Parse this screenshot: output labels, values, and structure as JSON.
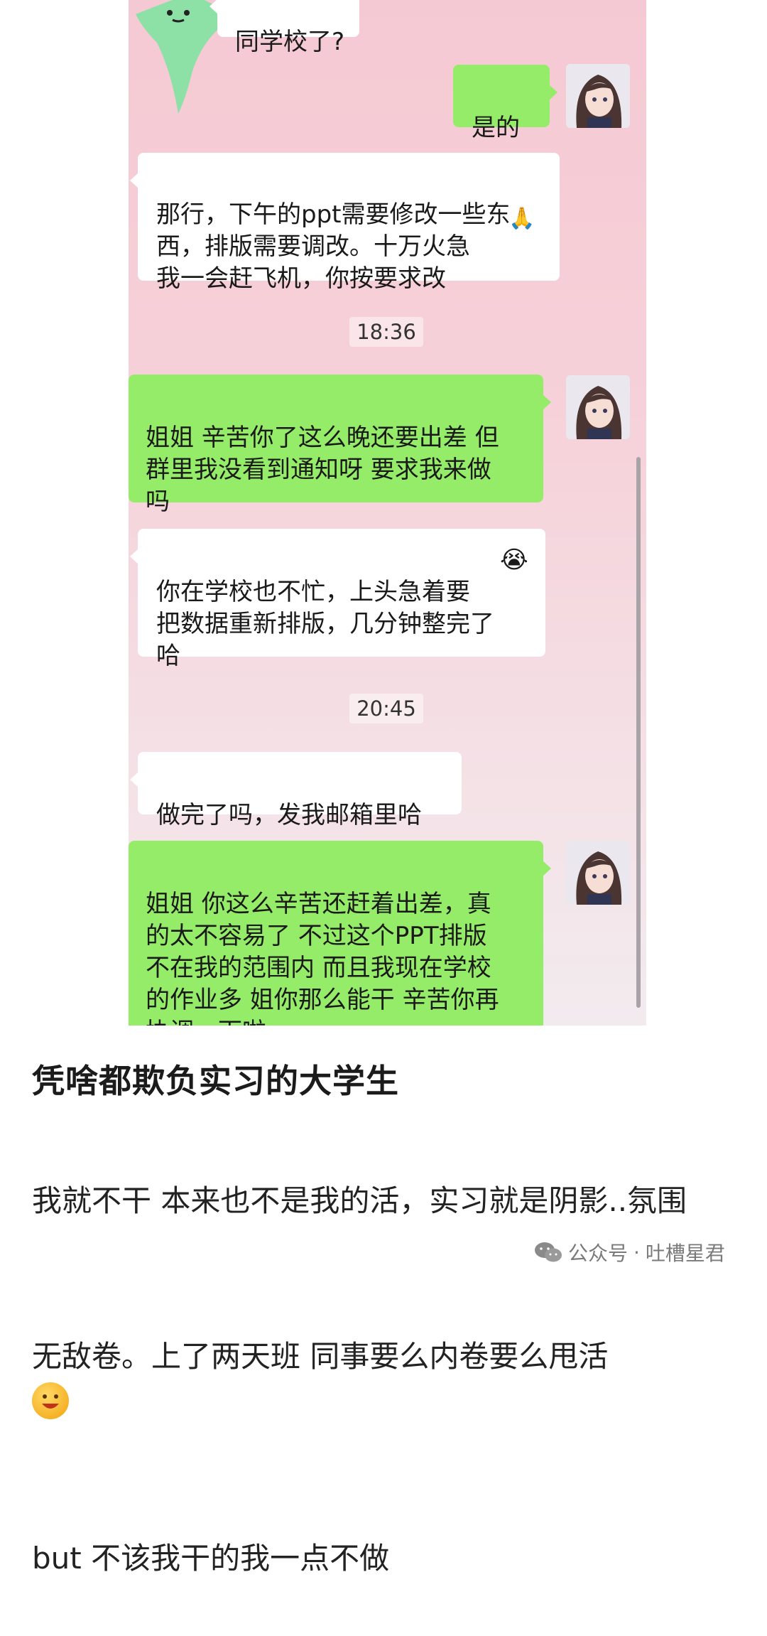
{
  "chat": {
    "partial_top_text": "同学校了?",
    "messages": [
      {
        "id": "m1",
        "side": "out",
        "text": "是的"
      },
      {
        "id": "m2",
        "side": "in",
        "text": "那行，下午的ppt需要修改一些东\n西，排版需要调改。十万火急\n我一会赶飞机，你按要求改"
      },
      {
        "id": "t1",
        "type": "time",
        "text": "18:36"
      },
      {
        "id": "m3",
        "side": "out",
        "text": "姐姐 辛苦你了这么晚还要出差 但\n群里我没看到通知呀 要求我来做\n吗"
      },
      {
        "id": "m4",
        "side": "in",
        "text": "你在学校也不忙，上头急着要\n把数据重新排版，几分钟整完了\n哈"
      },
      {
        "id": "t2",
        "type": "time",
        "text": "20:45"
      },
      {
        "id": "m5",
        "side": "in",
        "text": "做完了吗，发我邮箱里哈"
      },
      {
        "id": "m6",
        "side": "out",
        "text": "姐姐 你这么辛苦还赶着出差，真\n的太不容易了 不过这个PPT排版\n不在我的范围内 而且我现在学校\n的作业多 姐你那么能干 辛苦你再\n协调一下啦"
      }
    ],
    "icons": {
      "hands": "praying-hands-icon",
      "crying": "crying-laughing-emoji-icon",
      "sticker": "green-star-sticker-icon",
      "avatar": "anime-girl-avatar"
    }
  },
  "post": {
    "title": "凭啥都欺负实习的大学生",
    "body_line1": "我就不干 本来也不是我的活，实习就是阴影..氛围",
    "body_line2": "无敌卷。上了两天班 同事要么内卷要么甩活",
    "body_line3": "but 不该我干的我一点不做",
    "emoji": "grinning-emoji-icon"
  },
  "watermark": {
    "prefix": "公众号",
    "separator": "·",
    "name": "吐槽星君",
    "icon": "wechat-icon"
  },
  "colors": {
    "outgoing_bubble": "#95ec69",
    "incoming_bubble": "#ffffff",
    "chat_background": "#f5c9d3"
  }
}
